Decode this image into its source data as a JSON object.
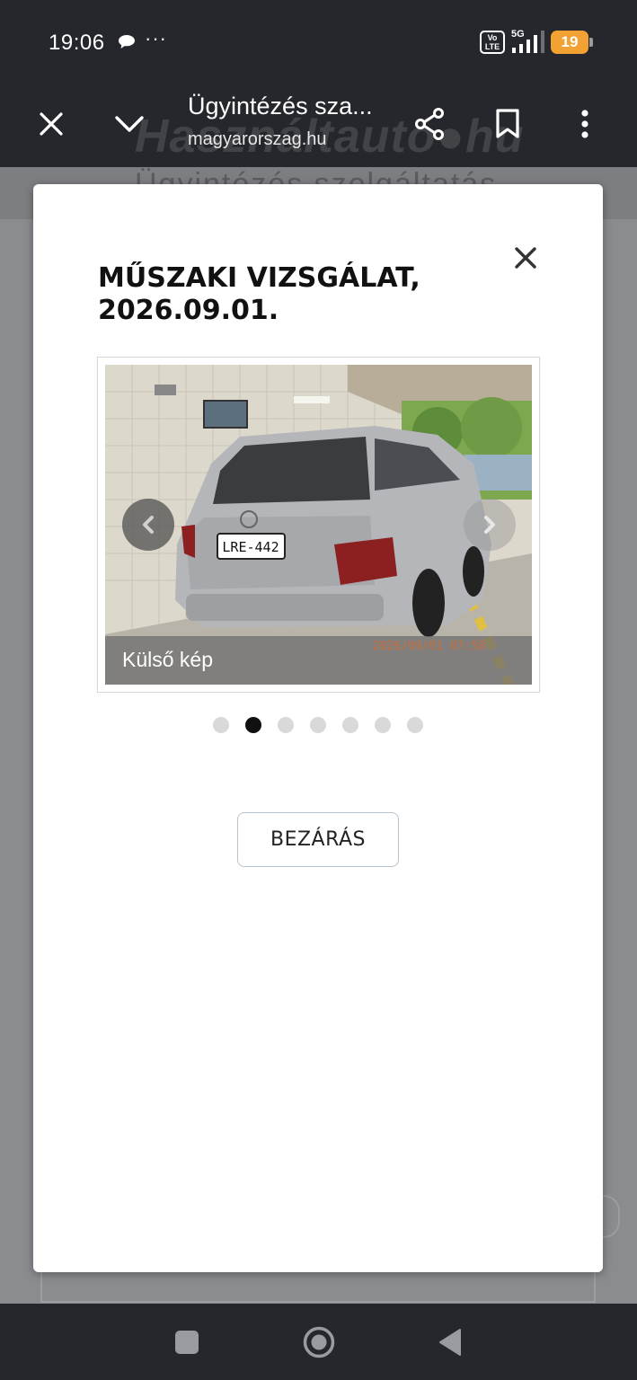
{
  "status_bar": {
    "time": "19:06",
    "more_indicator": "···",
    "network_badge": "Vo LTE",
    "network_type": "5G",
    "battery_level": "19",
    "icons": [
      "chat-bubble-icon",
      "volte-icon",
      "signal-icon",
      "battery-icon"
    ]
  },
  "browser": {
    "title": "Ügyintézés sza...",
    "url": "magyarorszag.hu",
    "icons": [
      "close-icon",
      "chevron-down-icon",
      "share-icon",
      "bookmark-icon",
      "more-vert-icon"
    ]
  },
  "background_page": {
    "heading_fragment": "Ügyintézés szolgáltatás",
    "watermark": "Használtautó●hu"
  },
  "modal": {
    "title_line1": "MŰSZAKI VIZSGÁLAT,",
    "title_line2": "2026.09.01.",
    "carousel": {
      "caption": "Külső kép",
      "photo_timestamp": "2026/09/01 07:58",
      "plate": "LRE-442",
      "slide_count": 7,
      "active_slide": 2
    },
    "close_button": "BEZÁRÁS"
  },
  "colors": {
    "system_bar": "#25272d",
    "battery": "#f2a233",
    "overlay": "#8a8c90"
  }
}
